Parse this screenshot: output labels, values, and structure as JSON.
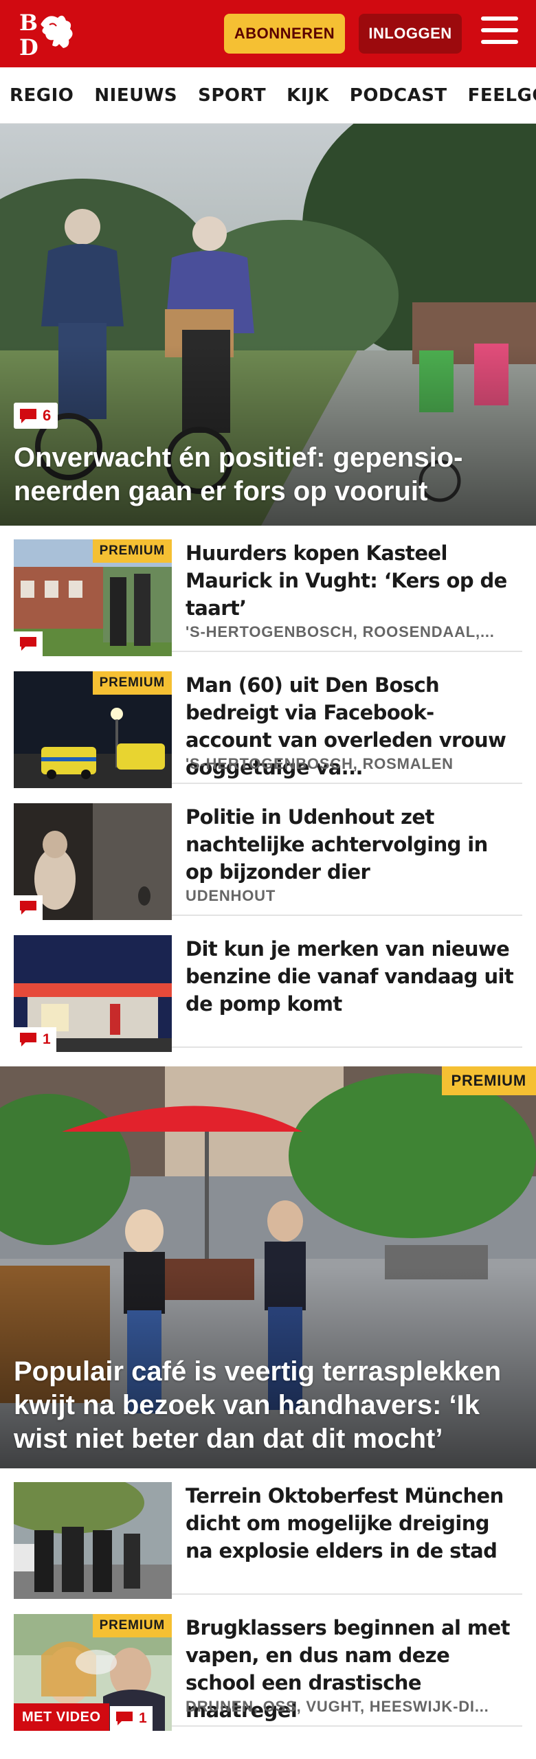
{
  "header": {
    "logo_text": "BD",
    "subscribe_label": "ABONNEREN",
    "login_label": "INLOGGEN",
    "colors": {
      "brand_red": "#d10a11",
      "accent_yellow": "#f5c033",
      "login_bg": "#9c0a0d"
    }
  },
  "nav": {
    "items": [
      "REGIO",
      "NIEUWS",
      "SPORT",
      "KIJK",
      "PODCAST",
      "FEELGOOD"
    ]
  },
  "hero": {
    "title": "Onverwacht én positief: gepensio­neerden gaan er fors op vooruit",
    "comments": "6"
  },
  "articles": [
    {
      "title": "Huurders kopen Kasteel Maurick in Vught: ‘Kers op de taart’",
      "meta": "'S-HERTOGENBOSCH, ROOSENDAAL,...",
      "premium": "PREMIUM"
    },
    {
      "title": "Man (60) uit Den Bosch bedreigt via Facebook-account van overleden vrouw ooggetuige va...",
      "meta": "'S-HERTOGENBOSCH, ROSMALEN",
      "premium": "PREMIUM"
    },
    {
      "title": "Politie in Udenhout zet nachtelij­ke achtervolging in op bijzonder dier",
      "meta": "UDENHOUT"
    },
    {
      "title": "Dit kun je merken van nieuwe benzine die vanaf vandaag uit de pomp komt",
      "comments": "1"
    }
  ],
  "feature": {
    "title": "Populair café is veertig terrasplekken kwijt na bezoek van handhavers: ‘Ik wist niet beter dan dat dit mocht’",
    "premium": "PREMIUM"
  },
  "articles2": [
    {
      "title": "Terrein Oktoberfest München dicht om mogelijke dreiging na explosie elders in de stad"
    },
    {
      "title": "Brugklassers beginnen al met vapen, en dus nam deze school een drastische maatregel",
      "meta": "DRUNEN, OSS, VUGHT, HEESWIJK-DI...",
      "premium": "PREMIUM",
      "video_label": "MET VIDEO",
      "comments": "1"
    }
  ]
}
